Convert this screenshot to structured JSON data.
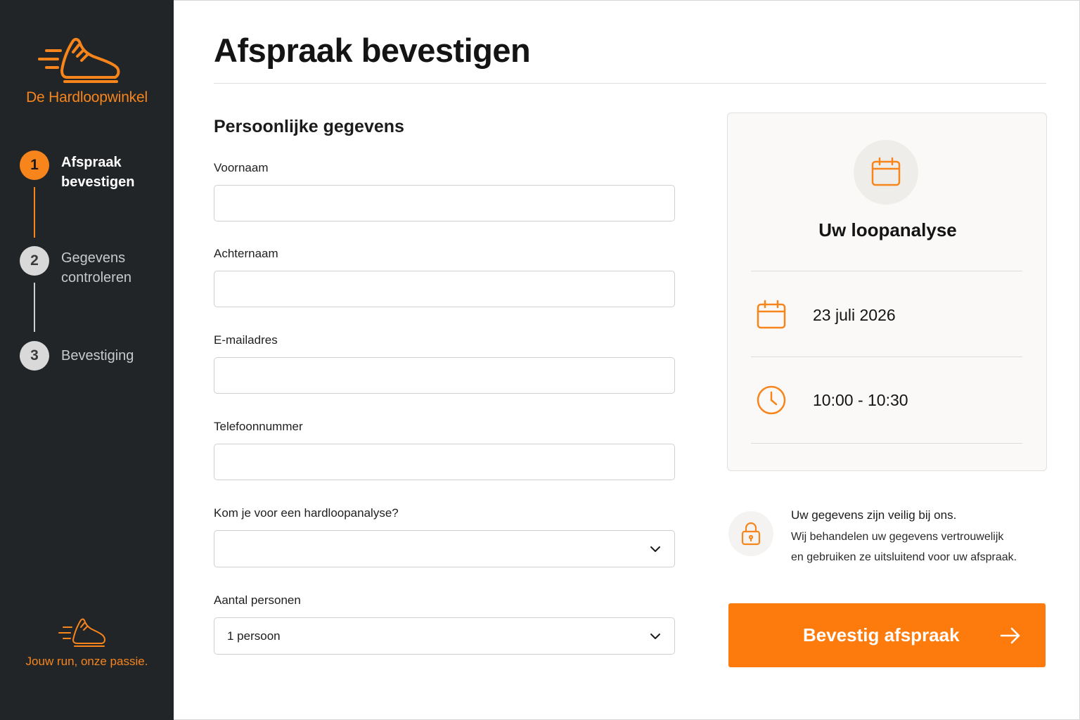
{
  "sidebar": {
    "brand_name": "De Hardloopwinkel",
    "steps": [
      {
        "number": "1",
        "label": "Afspraak bevestigen",
        "state": "active"
      },
      {
        "number": "2",
        "label": "Gegevens controleren",
        "state": "inactive"
      },
      {
        "number": "3",
        "label": "Bevestiging",
        "state": "inactive"
      }
    ],
    "tagline": "Jouw run, onze passie."
  },
  "main": {
    "title": "Afspraak bevestigen",
    "section_title": "Persoonlijke gegevens",
    "fields": {
      "first_name": {
        "label": "Voornaam",
        "value": ""
      },
      "last_name": {
        "label": "Achternaam",
        "value": ""
      },
      "email": {
        "label": "E-mailadres",
        "value": ""
      },
      "phone": {
        "label": "Telefoonnummer",
        "value": ""
      },
      "analysis": {
        "label": "Kom je voor een hardloopanalyse?",
        "value": ""
      },
      "persons": {
        "label": "Aantal personen",
        "value": "1 persoon"
      }
    }
  },
  "summary": {
    "title": "Uw loopanalyse",
    "date": "23 juli 2026",
    "time": "10:00 - 10:30"
  },
  "security": {
    "title": "Uw gegevens zijn veilig bij ons.",
    "line1": "Wij behandelen uw gegevens vertrouwelijk",
    "line2": "en gebruiken ze uitsluitend voor uw afspraak."
  },
  "confirm_button": {
    "label": "Bevestig afspraak"
  },
  "colors": {
    "accent": "#fd7b0d",
    "sidebar": "#222527",
    "card_bg": "#faf9f7"
  }
}
